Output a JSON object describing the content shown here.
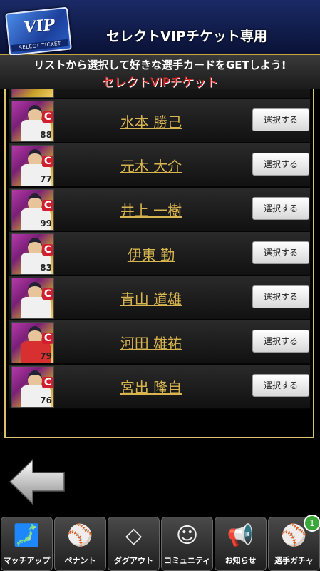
{
  "header": {
    "vip_card_text": "VIP",
    "vip_card_sub": "SELECT TICKET",
    "title": "セレクトVIPチケット専用"
  },
  "subband": {
    "instruction": "リストから選択して好きな選手カードをGETしよう!",
    "ticket_name": "セレクトVIPチケット"
  },
  "players": [
    {
      "name": "水本 勝己",
      "number": "88",
      "button": "選択する"
    },
    {
      "name": "元木 大介",
      "number": "77",
      "button": "選択する"
    },
    {
      "name": "井上 一樹",
      "number": "99",
      "button": "選択する"
    },
    {
      "name": "伊東 勤",
      "number": "83",
      "button": "選択する"
    },
    {
      "name": "青山 道雄",
      "number": "",
      "button": "選択する"
    },
    {
      "name": "河田 雄祐",
      "number": "79",
      "button": "選択する"
    },
    {
      "name": "宮出 隆自",
      "number": "76",
      "button": "選択する"
    }
  ],
  "card_badge": "C",
  "nav": [
    {
      "label": "マッチアップ",
      "icon": "japan-map-icon"
    },
    {
      "label": "ペナント",
      "icon": "pennant-icon"
    },
    {
      "label": "ダグアウト",
      "icon": "dugout-icon"
    },
    {
      "label": "コミュニティ",
      "icon": "community-icon"
    },
    {
      "label": "お知らせ",
      "icon": "megaphone-icon"
    },
    {
      "label": "選手ガチャ",
      "icon": "gacha-player-icon",
      "badge": "1"
    }
  ]
}
